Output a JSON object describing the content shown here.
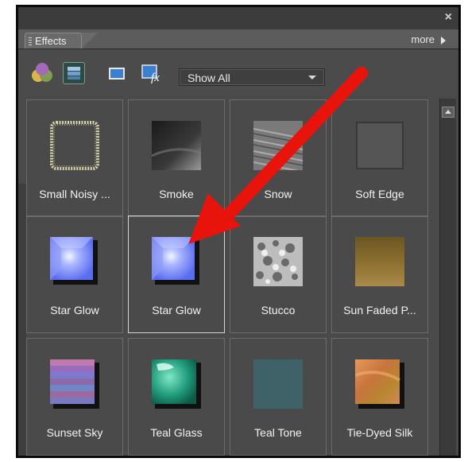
{
  "panel": {
    "close_glyph": "×",
    "tab_label": "Effects",
    "more_label": "more"
  },
  "toolbar": {
    "icons": [
      "filters-icon",
      "layer-styles-icon",
      "photo-effects-icon",
      "fx-icon"
    ],
    "filter_select": {
      "value": "Show All"
    }
  },
  "effects": [
    {
      "label": "Small Noisy ...",
      "thumb": "noisy-frame"
    },
    {
      "label": "Smoke",
      "thumb": "smoke"
    },
    {
      "label": "Snow",
      "thumb": "snow"
    },
    {
      "label": "Soft Edge",
      "thumb": "soft-edge"
    },
    {
      "label": "Star Glow",
      "thumb": "star-glow"
    },
    {
      "label": "Star Glow",
      "thumb": "star-glow",
      "selected": true
    },
    {
      "label": "Stucco",
      "thumb": "stucco"
    },
    {
      "label": "Sun Faded P...",
      "thumb": "sun-faded"
    },
    {
      "label": "Sunset Sky",
      "thumb": "sunset-sky"
    },
    {
      "label": "Teal Glass",
      "thumb": "teal-glass"
    },
    {
      "label": "Teal Tone",
      "thumb": "teal-tone"
    },
    {
      "label": "Tie-Dyed Silk",
      "thumb": "tie-dyed"
    }
  ],
  "annotation": {
    "color": "#e8140c",
    "type": "arrow"
  }
}
